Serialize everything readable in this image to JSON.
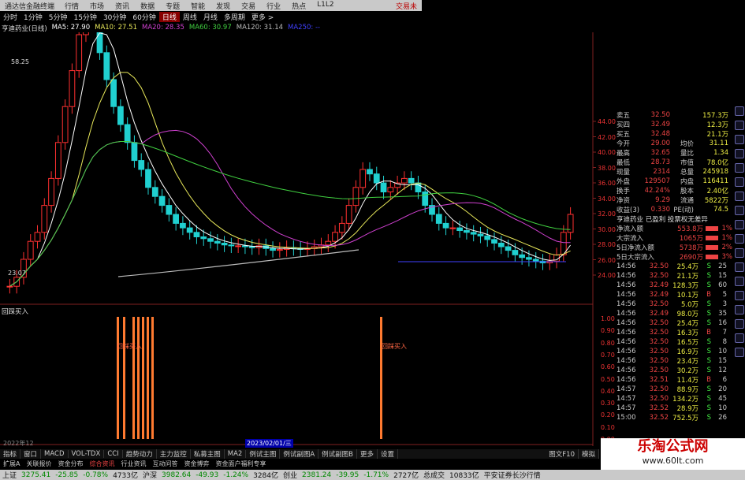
{
  "window": {
    "title": "通达信金融终端",
    "menu": [
      "行情",
      "市场",
      "资讯",
      "数据",
      "专题",
      "智能",
      "发现",
      "交易",
      "行业",
      "热点",
      "L1L2"
    ],
    "right_label": "交易未"
  },
  "toolbar": {
    "periods": [
      "分时",
      "1分钟",
      "5分钟",
      "15分钟",
      "30分钟",
      "60分钟",
      "日线",
      "周线",
      "月线",
      "多周期",
      "更多 >"
    ],
    "active_period": "日线"
  },
  "legend": {
    "stock": "亨迪药业(日线)",
    "ma": [
      {
        "label": "MA5: 27.90",
        "color": "#ffffff"
      },
      {
        "label": "MA10: 27.51",
        "color": "#e8e85a"
      },
      {
        "label": "MA20: 28.35",
        "color": "#d040d0"
      },
      {
        "label": "MA60: 30.97",
        "color": "#40d040"
      },
      {
        "label": "MA120: 31.14",
        "color": "#bbbbbb"
      },
      {
        "label": "MA250: --",
        "color": "#4040ff"
      }
    ]
  },
  "price_labels": {
    "high": "58.25",
    "low": "23.07"
  },
  "price_axis": [
    "44.00",
    "42.00",
    "40.00",
    "38.00",
    "36.00",
    "34.00",
    "32.00",
    "30.00",
    "28.00",
    "26.00",
    "24.00"
  ],
  "indicator": {
    "title": "回踩买入",
    "signal_label": "回踩买入",
    "axis": [
      "1.00",
      "0.90",
      "0.80",
      "0.70",
      "0.60",
      "0.50",
      "0.40",
      "0.30",
      "0.20",
      "0.10",
      "0.00"
    ]
  },
  "date_label": "2023/02/01/三",
  "start_date": "2022年12",
  "quote_panel": {
    "order_book": [
      {
        "label": "卖五",
        "price": "32.50",
        "vol": "157.3万"
      },
      {
        "label": "买四",
        "price": "32.49",
        "vol": "12.3万"
      },
      {
        "label": "买五",
        "price": "32.48",
        "vol": "21.1万"
      }
    ],
    "stats": [
      {
        "l1": "今开",
        "v1": "29.00",
        "l2": "均价",
        "v2": "31.11"
      },
      {
        "l1": "最高",
        "v1": "32.65",
        "l2": "量比",
        "v2": "1.34"
      },
      {
        "l1": "最低",
        "v1": "28.73",
        "l2": "市值",
        "v2": "78.0亿"
      },
      {
        "l1": "现量",
        "v1": "2314",
        "l2": "总量",
        "v2": "245918"
      },
      {
        "l1": "外盘",
        "v1": "129507",
        "l2": "内盘",
        "v2": "116411"
      },
      {
        "l1": "换手",
        "v1": "42.24%",
        "l2": "股本",
        "v2": "2.40亿"
      },
      {
        "l1": "净资",
        "v1": "9.29",
        "l2": "流通",
        "v2": "5822万"
      },
      {
        "l1": "收益(3)",
        "v1": "0.330",
        "l2": "PE(动)",
        "v2": "74.5"
      }
    ],
    "fund_header": "亨迪药业  已盈利  投票权无差异",
    "funds": [
      {
        "label": "净流入额",
        "value": "553.8万",
        "pct": "1%"
      },
      {
        "label": "大宗流入",
        "value": "1065万",
        "pct": "1%"
      },
      {
        "label": "5日净流入额",
        "value": "5738万",
        "pct": "2%"
      },
      {
        "label": "5日大宗流入",
        "value": "2690万",
        "pct": "3%"
      }
    ],
    "ticks": [
      {
        "t": "14:56",
        "p": "32.50",
        "v": "25.4万",
        "bs": "S",
        "n": "25"
      },
      {
        "t": "14:56",
        "p": "32.50",
        "v": "21.1万",
        "bs": "S",
        "n": "15"
      },
      {
        "t": "14:56",
        "p": "32.49",
        "v": "128.3万",
        "bs": "S",
        "n": "60"
      },
      {
        "t": "14:56",
        "p": "32.49",
        "v": "10.1万",
        "bs": "B",
        "n": "5"
      },
      {
        "t": "14:56",
        "p": "32.50",
        "v": "5.0万",
        "bs": "S",
        "n": "3"
      },
      {
        "t": "14:56",
        "p": "32.49",
        "v": "98.0万",
        "bs": "S",
        "n": "35"
      },
      {
        "t": "14:56",
        "p": "32.50",
        "v": "25.4万",
        "bs": "S",
        "n": "16"
      },
      {
        "t": "14:56",
        "p": "32.50",
        "v": "16.3万",
        "bs": "B",
        "n": "7"
      },
      {
        "t": "14:56",
        "p": "32.50",
        "v": "16.5万",
        "bs": "S",
        "n": "8"
      },
      {
        "t": "14:56",
        "p": "32.50",
        "v": "16.9万",
        "bs": "S",
        "n": "10"
      },
      {
        "t": "14:56",
        "p": "32.50",
        "v": "23.4万",
        "bs": "S",
        "n": "15"
      },
      {
        "t": "14:56",
        "p": "32.50",
        "v": "30.2万",
        "bs": "S",
        "n": "12"
      },
      {
        "t": "14:56",
        "p": "32.51",
        "v": "11.4万",
        "bs": "B",
        "n": "6"
      },
      {
        "t": "14:57",
        "p": "32.50",
        "v": "88.9万",
        "bs": "S",
        "n": "20"
      },
      {
        "t": "14:57",
        "p": "32.50",
        "v": "134.2万",
        "bs": "S",
        "n": "45"
      },
      {
        "t": "14:57",
        "p": "32.52",
        "v": "28.9万",
        "bs": "S",
        "n": "10"
      },
      {
        "t": "15:00",
        "p": "32.52",
        "v": "752.5万",
        "bs": "S",
        "n": "26"
      }
    ]
  },
  "bottom_tabs": [
    "指标",
    "窗口",
    "MACD",
    "VOL-TDX",
    "CCI",
    "趋势动力",
    "主力监控",
    "私募主图",
    "MA2",
    "例试主图",
    "例试副图A",
    "例试副图B",
    "更多",
    "设置"
  ],
  "sub_tabs": [
    "扩展A",
    "关联报价",
    "资金分布",
    "综合资讯",
    "行业资讯",
    "互动问答",
    "资金博弈",
    "资金面户福利专享"
  ],
  "status": {
    "sh_label": "上证",
    "sh_val": "3275.41",
    "sh_chg": "-25.85",
    "sh_pct": "-0.78%",
    "sh_amt": "4733亿",
    "sz_label": "沪深",
    "sz_val": "3982.64",
    "sz_chg": "-49.93",
    "sz_pct": "-1.24%",
    "sz_amt": "3284亿",
    "cy_label": "创业",
    "cy_val": "2381.24",
    "cy_chg": "-39.95",
    "cy_pct": "-1.71%",
    "cy_amt": "2727亿",
    "total_label": "总成交",
    "total_val": "10833亿",
    "broker": "平安证券长沙行情"
  },
  "watermark": {
    "line1": "乐淘公式网",
    "line2": "www.60lt.com"
  },
  "right_tabs": [
    "图文F10",
    "模拟"
  ]
}
